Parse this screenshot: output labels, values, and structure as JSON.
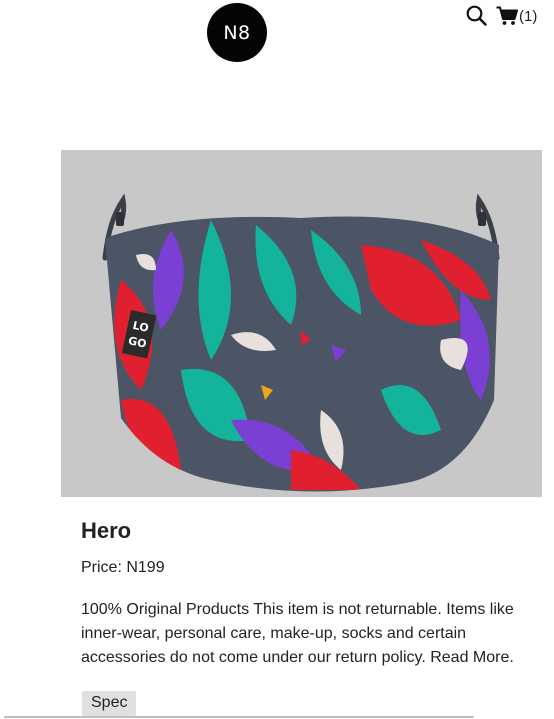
{
  "header": {
    "logo_text": "N8",
    "search_icon": "search-icon",
    "cart_icon": "cart-icon",
    "cart_count": "(1)"
  },
  "product": {
    "name": "Hero",
    "price": "Price: N199",
    "description": "100% Original Products This item is not returnable. Items like inner-wear, personal care, make-up, socks and certain accessories do not come under our return policy. Read More.",
    "spec_label": "Spec"
  },
  "colors": {
    "image_background": "#c8c8c8",
    "mask_base": "#4c5566",
    "teal": "#14b39c",
    "red": "#e0202e",
    "purple": "#7c3fd4"
  }
}
